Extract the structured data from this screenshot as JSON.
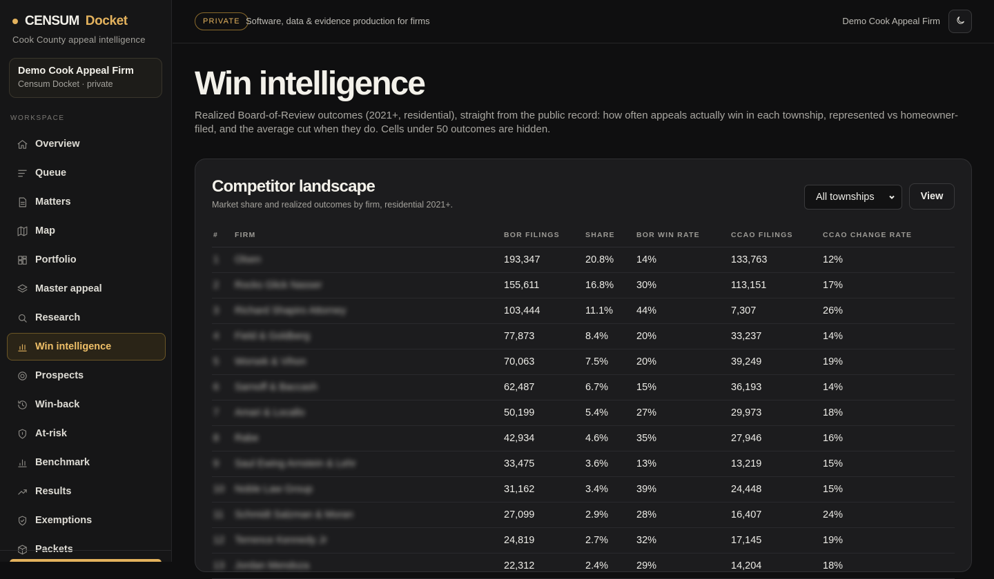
{
  "sidebar": {
    "brand_main": "CENSUM",
    "brand_accent": "Docket",
    "brand_sub": "Cook County appeal intelligence",
    "firm_card": {
      "title": "Demo Cook Appeal Firm",
      "subtitle": "Censum Docket · private"
    },
    "section_label": "WORKSPACE",
    "items": [
      {
        "label": "Overview",
        "icon": "home-icon"
      },
      {
        "label": "Queue",
        "icon": "list-icon"
      },
      {
        "label": "Matters",
        "icon": "document-icon"
      },
      {
        "label": "Map",
        "icon": "map-icon"
      },
      {
        "label": "Portfolio",
        "icon": "grid-icon"
      },
      {
        "label": "Master appeal",
        "icon": "layers-icon"
      },
      {
        "label": "Research",
        "icon": "search-icon"
      },
      {
        "label": "Win intelligence",
        "icon": "bar-chart-icon",
        "active": true
      },
      {
        "label": "Prospects",
        "icon": "target-icon"
      },
      {
        "label": "Win-back",
        "icon": "history-icon"
      },
      {
        "label": "At-risk",
        "icon": "shield-icon"
      },
      {
        "label": "Benchmark",
        "icon": "bar-chart-icon"
      },
      {
        "label": "Results",
        "icon": "trend-up-icon"
      },
      {
        "label": "Exemptions",
        "icon": "shield-check-icon"
      },
      {
        "label": "Packets",
        "icon": "package-icon"
      }
    ],
    "accent_color": "#e3b25d"
  },
  "topbar": {
    "badge": "PRIVATE",
    "tagline": "Software, data & evidence production for firms",
    "firm_name": "Demo Cook Appeal Firm",
    "theme_icon": "moon-icon"
  },
  "page": {
    "title": "Win intelligence",
    "description": "Realized Board-of-Review outcomes (2021+, residential), straight from the public record: how often appeals actually win in each township, represented vs homeowner-filed, and the average cut when they do. Cells under 50 outcomes are hidden."
  },
  "competitor": {
    "title": "Competitor landscape",
    "subtitle": "Market share and realized outcomes by firm, residential 2021+.",
    "select_value": "All townships",
    "view_label": "View",
    "columns": [
      "#",
      "FIRM",
      "BOR FILINGS",
      "SHARE",
      "BOR WIN RATE",
      "CCAO FILINGS",
      "CCAO CHANGE RATE"
    ],
    "rows": [
      {
        "rank": "1",
        "firm": "Olsen",
        "bor": "193,347",
        "share": "20.8%",
        "win": "14%",
        "ccao": "133,763",
        "chg": "12%"
      },
      {
        "rank": "2",
        "firm": "Rocks Glick Nasser",
        "bor": "155,611",
        "share": "16.8%",
        "win": "30%",
        "ccao": "113,151",
        "chg": "17%"
      },
      {
        "rank": "3",
        "firm": "Richard Shapiro Attorney",
        "bor": "103,444",
        "share": "11.1%",
        "win": "44%",
        "ccao": "7,307",
        "chg": "26%"
      },
      {
        "rank": "4",
        "firm": "Field & Goldberg",
        "bor": "77,873",
        "share": "8.4%",
        "win": "20%",
        "ccao": "33,237",
        "chg": "14%"
      },
      {
        "rank": "5",
        "firm": "Worsek & Vihon",
        "bor": "70,063",
        "share": "7.5%",
        "win": "20%",
        "ccao": "39,249",
        "chg": "19%"
      },
      {
        "rank": "6",
        "firm": "Sarnoff & Baccash",
        "bor": "62,487",
        "share": "6.7%",
        "win": "15%",
        "ccao": "36,193",
        "chg": "14%"
      },
      {
        "rank": "7",
        "firm": "Amari & Locallo",
        "bor": "50,199",
        "share": "5.4%",
        "win": "27%",
        "ccao": "29,973",
        "chg": "18%"
      },
      {
        "rank": "8",
        "firm": "Rabe",
        "bor": "42,934",
        "share": "4.6%",
        "win": "35%",
        "ccao": "27,946",
        "chg": "16%"
      },
      {
        "rank": "9",
        "firm": "Saul Ewing Arnstein & Lehr",
        "bor": "33,475",
        "share": "3.6%",
        "win": "13%",
        "ccao": "13,219",
        "chg": "15%"
      },
      {
        "rank": "10",
        "firm": "Noble Law Group",
        "bor": "31,162",
        "share": "3.4%",
        "win": "39%",
        "ccao": "24,448",
        "chg": "15%"
      },
      {
        "rank": "11",
        "firm": "Schmidt Salzman & Moran",
        "bor": "27,099",
        "share": "2.9%",
        "win": "28%",
        "ccao": "16,407",
        "chg": "24%"
      },
      {
        "rank": "12",
        "firm": "Terrence Kennedy Jr",
        "bor": "24,819",
        "share": "2.7%",
        "win": "32%",
        "ccao": "17,145",
        "chg": "19%"
      },
      {
        "rank": "13",
        "firm": "Jordan Mendoza",
        "bor": "22,312",
        "share": "2.4%",
        "win": "29%",
        "ccao": "14,204",
        "chg": "18%"
      }
    ]
  }
}
